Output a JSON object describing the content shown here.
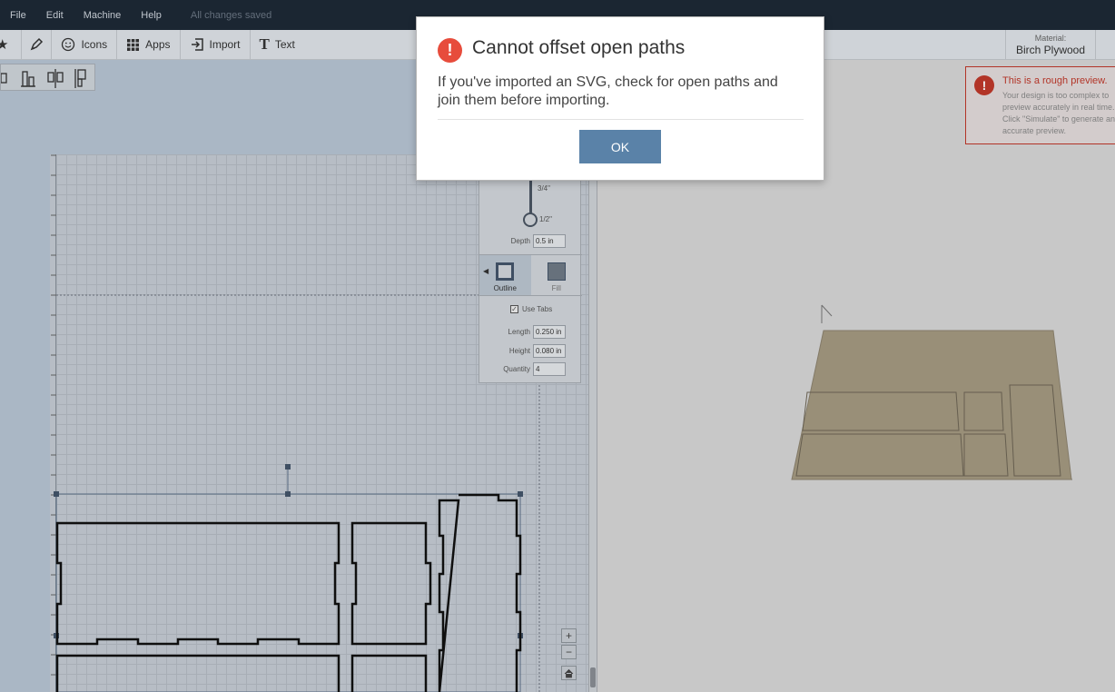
{
  "menubar": {
    "items": [
      "File",
      "Edit",
      "Machine",
      "Help"
    ],
    "status": "All changes saved"
  },
  "toolbar": {
    "icons_label": "Icons",
    "apps_label": "Apps",
    "import_label": "Import",
    "text_label": "Text",
    "material_label": "Material:",
    "material_value": "Birch Plywood"
  },
  "side_panel": {
    "frac_top": "3/4\"",
    "frac_bottom": "1/2\"",
    "depth_label": "Depth",
    "depth_value": "0.5 in",
    "outline_label": "Outline",
    "fill_label": "Fill",
    "use_tabs_label": "Use Tabs",
    "length_label": "Length",
    "length_value": "0.250 in",
    "height_label": "Height",
    "height_value": "0.080 in",
    "quantity_label": "Quantity",
    "quantity_value": "4"
  },
  "preview_warning": {
    "title": "This is a rough preview.",
    "text": "Your design is too complex to preview accurately in real time. Click \"Simulate\" to generate an accurate preview."
  },
  "dialog": {
    "title": "Cannot offset open paths",
    "body": "If you've imported an SVG, check for open paths and join them before importing.",
    "ok_label": "OK"
  },
  "colors": {
    "menubar_bg": "#1e2936",
    "dialog_icon": "#e74c3c",
    "ok_button": "#5a82a8",
    "warning": "#c0392b"
  }
}
